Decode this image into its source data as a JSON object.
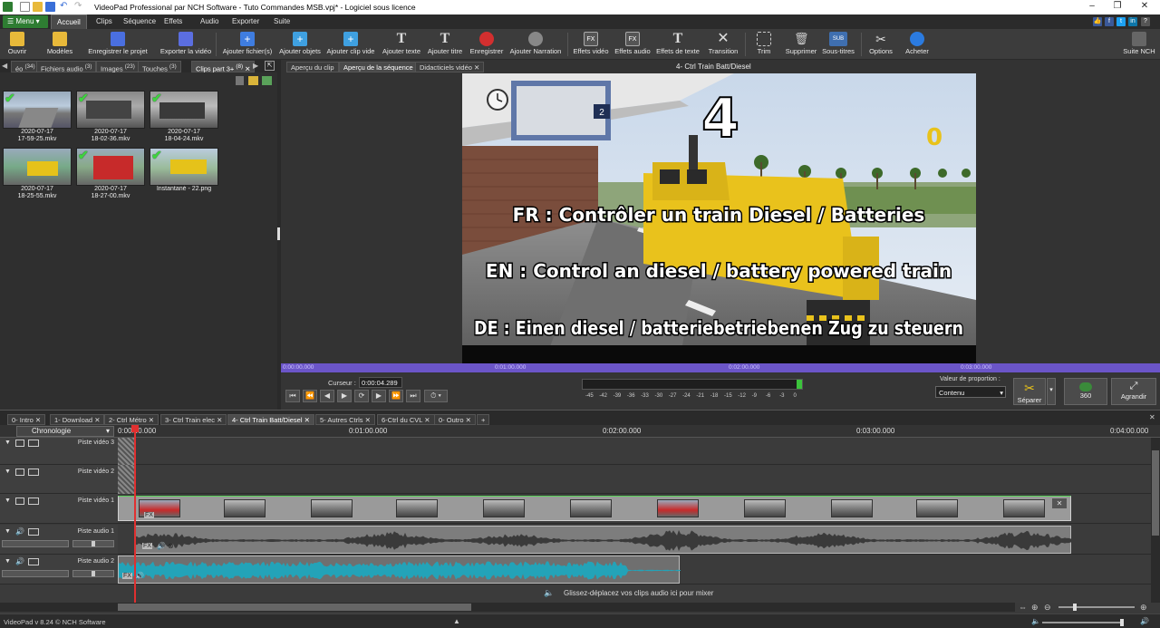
{
  "titlebar": {
    "title": "VideoPad Professional par NCH Software - Tuto Commandes MSB.vpj* - Logiciel sous licence",
    "min": "–",
    "max": "❐",
    "close": "✕"
  },
  "menubar": {
    "menu_label": "Menu ▾",
    "tabs": [
      "Accueil",
      "Clips",
      "Séquence",
      "Effets",
      "Audio",
      "Exporter",
      "Suite"
    ]
  },
  "toolbar": {
    "buttons": [
      "Ouvrir",
      "Modèles",
      "Enregistrer le projet",
      "Exporter la vidéo",
      "Ajouter fichier(s)",
      "Ajouter objets",
      "Ajouter clip vide",
      "Ajouter texte",
      "Ajouter titre",
      "Enregistrer",
      "Ajouter Narration",
      "Effets vidéo",
      "Effets audio",
      "Effets de texte",
      "Transition",
      "Trim",
      "Supprimer",
      "Sous-titres",
      "Options",
      "Acheter",
      "Suite NCH"
    ],
    "icon_text": [
      "T",
      "T",
      "FX",
      "FX",
      "T",
      "SUB"
    ]
  },
  "bin": {
    "tabs": [
      "éo",
      "Fichiers audio",
      "Images",
      "Touches",
      "Clips part 3+"
    ],
    "tab_counts": [
      "(34)",
      "(3)",
      "(23)",
      "(3)",
      "(8)"
    ],
    "clips": [
      {
        "line1": "2020-07-17",
        "line2": "17-59-25.mkv"
      },
      {
        "line1": "2020-07-17",
        "line2": "18-02-36.mkv"
      },
      {
        "line1": "2020-07-17",
        "line2": "18-04-24.mkv"
      },
      {
        "line1": "2020-07-17",
        "line2": "18-25-55.mkv"
      },
      {
        "line1": "2020-07-17",
        "line2": "18-27-00.mkv"
      },
      {
        "line1": "Instantané - 22.png",
        "line2": ""
      }
    ]
  },
  "preview": {
    "tabs": [
      "Aperçu du clip",
      "Aperçu de la séquence",
      "Didacticiels vidéo"
    ],
    "sequence_title": "4- Ctrl Train Batt/Diesel",
    "overlay_number": "4",
    "overlay_zero": "0",
    "platform_sign": "2",
    "caption_fr": "FR : Contrôler un train Diesel / Batteries",
    "caption_en": "EN : Control an diesel / battery powered train",
    "caption_de": "DE : Einen diesel / batteriebetriebenen Zug zu steuern",
    "seek_ticks": [
      "0:00:00.000",
      "0:01:00.000",
      "0:02:00.000",
      "0:03:00.000"
    ],
    "cursor_label": "Curseur :",
    "cursor_value": "0:00:04.289",
    "meter_ticks": [
      "-45",
      "-42",
      "-39",
      "-36",
      "-33",
      "-30",
      "-27",
      "-24",
      "-21",
      "-18",
      "-15",
      "-12",
      "-9",
      "-6",
      "-3",
      "0"
    ],
    "aspect_label": "Valeur de proportion :",
    "aspect_value": "Contenu",
    "separate_label": "Séparer",
    "btn_360": "360",
    "enlarge_label": "Agrandir"
  },
  "sequences": {
    "tabs": [
      "0- Intro",
      "1- Download",
      "2- Ctrl Métro",
      "3- Ctrl Train elec",
      "4- Ctrl Train Batt/Diesel",
      "5- Autres Ctrls",
      "6-Ctrl du CVL",
      "0- Outro"
    ],
    "add": "+",
    "close": "✕"
  },
  "timeline": {
    "mode": "Chronologie",
    "ruler": [
      "0:00:00.000",
      "0:01:00.000",
      "0:02:00.000",
      "0:03:00.000",
      "0:04:00.000"
    ],
    "tracks": [
      "Piste vidéo 3",
      "Piste vidéo 2",
      "Piste vidéo 1",
      "Piste audio 1",
      "Piste audio 2"
    ],
    "fx": "FX",
    "drop_hint": "Glissez-déplacez vos clips audio ici pour mixer"
  },
  "status": {
    "text": "VideoPad v 8.24 © NCH Software"
  },
  "colors": {
    "accent": "#2e7d32",
    "seek": "#6b55c8",
    "audio2": "#23a3b8",
    "playhead": "#e03030"
  }
}
